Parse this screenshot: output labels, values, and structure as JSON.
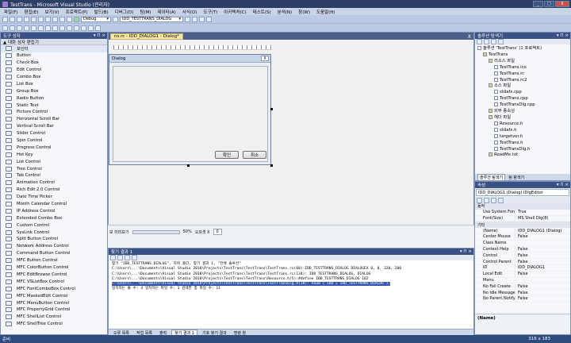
{
  "window": {
    "title": "TestTrans - Microsoft Visual Studio (관리자)",
    "min": "_",
    "max": "□",
    "close": "X"
  },
  "menu": [
    "파일(F)",
    "편집(E)",
    "보기(V)",
    "프로젝트(P)",
    "빌드(B)",
    "디버그(D)",
    "팀(M)",
    "데이터(A)",
    "서식(O)",
    "도구(T)",
    "아키텍처(C)",
    "테스트(S)",
    "분석(N)",
    "창(W)",
    "도움말(H)"
  ],
  "toolbar": {
    "config": "Debug",
    "dialog_id": "IDD_TESTTRANS_DIALOG"
  },
  "toolbox": {
    "title": "도구 상자",
    "group": "▲ 대화 상자 편집기",
    "items": [
      {
        "icon": "pointer-icon",
        "label": "포인터"
      },
      {
        "icon": "button-icon",
        "label": "Button"
      },
      {
        "icon": "check-box-icon",
        "label": "Check Box"
      },
      {
        "icon": "edit-control-icon",
        "label": "Edit Control"
      },
      {
        "icon": "combo-box-icon",
        "label": "Combo Box"
      },
      {
        "icon": "list-box-icon",
        "label": "List Box"
      },
      {
        "icon": "group-box-icon",
        "label": "Group Box"
      },
      {
        "icon": "radio-button-icon",
        "label": "Radio Button"
      },
      {
        "icon": "static-text-icon",
        "label": "Static Text"
      },
      {
        "icon": "picture-control-icon",
        "label": "Picture Control"
      },
      {
        "icon": "h-scroll-icon",
        "label": "Horizontal Scroll Bar"
      },
      {
        "icon": "v-scroll-icon",
        "label": "Vertical Scroll Bar"
      },
      {
        "icon": "slider-icon",
        "label": "Slider Control"
      },
      {
        "icon": "spin-icon",
        "label": "Spin Control"
      },
      {
        "icon": "progress-icon",
        "label": "Progress Control"
      },
      {
        "icon": "hot-key-icon",
        "label": "Hot Key"
      },
      {
        "icon": "list-control-icon",
        "label": "List Control"
      },
      {
        "icon": "tree-control-icon",
        "label": "Tree Control"
      },
      {
        "icon": "tab-control-icon",
        "label": "Tab Control"
      },
      {
        "icon": "animation-icon",
        "label": "Animation Control"
      },
      {
        "icon": "rich-edit-icon",
        "label": "Rich Edit 2.0 Control"
      },
      {
        "icon": "date-time-icon",
        "label": "Date Time Picker"
      },
      {
        "icon": "month-calendar-icon",
        "label": "Month Calendar Control"
      },
      {
        "icon": "ip-address-icon",
        "label": "IP Address Control"
      },
      {
        "icon": "ext-combo-icon",
        "label": "Extended Combo Box"
      },
      {
        "icon": "custom-control-icon",
        "label": "Custom Control"
      },
      {
        "icon": "syslink-icon",
        "label": "SysLink Control"
      },
      {
        "icon": "split-button-icon",
        "label": "Split Button Control"
      },
      {
        "icon": "network-address-icon",
        "label": "Network Address Control"
      },
      {
        "icon": "command-button-icon",
        "label": "Command Button Control"
      },
      {
        "icon": "mfc-button-icon",
        "label": "MFC Button Control"
      },
      {
        "icon": "mfc-colorbutton-icon",
        "label": "MFC ColorButton Control"
      },
      {
        "icon": "mfc-editbrowse-icon",
        "label": "MFC EditBrowse Control"
      },
      {
        "icon": "mfc-vslistbox-icon",
        "label": "MFC VSListBox Control"
      },
      {
        "icon": "mfc-fontcombo-icon",
        "label": "MFC FontComboBox Control"
      },
      {
        "icon": "mfc-maskededit-icon",
        "label": "MFC MaskedEdit Control"
      },
      {
        "icon": "mfc-menubutton-icon",
        "label": "MFC MenuButton Control"
      },
      {
        "icon": "mfc-propertygrid-icon",
        "label": "MFC PropertyGrid Control"
      },
      {
        "icon": "mfc-shelllist-icon",
        "label": "MFC ShellList Control"
      },
      {
        "icon": "mfc-shelltree-icon",
        "label": "MFC ShellTree Control"
      }
    ]
  },
  "doc": {
    "tab": "ns.rc - IDD_DIALOG1 - Dialog*",
    "dialog_title": "Dialog",
    "ok": "확인",
    "cancel": "취소",
    "close": "X"
  },
  "sizer": {
    "label": "보 미리보기",
    "percent": "50%",
    "scale_label": "오프셋 X",
    "value": "0"
  },
  "output": {
    "lines": [
      "찾기 \"IDD_TESTTRANS_DIALOG\", 하위 폴더, 찾기 결과 1, \"전체 솔루션\"",
      "C:\\Users\\...\\Documents\\Visual Studio 2010\\Projects\\TestTrans\\TestTrans\\TestTrans.rc(68):IDD_TESTTRANS_DIALOG DIALOGEX  0, 0, 320, 200",
      "C:\\Users\\...\\Documents\\Visual Studio 2010\\Projects\\TestTrans\\TestTrans\\TestTrans.rc(134):   IDD_TESTTRANS_DIALOG, DIALOG",
      "C:\\Users\\...\\Documents\\Visual Studio 2010\\Projects\\TestTrans\\TestTrans\\Resource.h(5):#define IDD_TESTTRANS_DIALOG              102",
      "C:\\Users\\...\\Documents\\Visual Studio 2010\\Projects\\TestTrans\\TestTrans\\TestTransDlg.h(18):   enum { IDD = IDD_TESTTRANS_DIALOG };",
      "일치하는 줄 수: 4    일치하는 파일 수: 3    검색한 총 파일 수: 11"
    ],
    "highlight_index": 4,
    "tabs": [
      "오류 목록",
      "작업 목록",
      "출력",
      "찾기 결과 1",
      "기호 찾기 결과",
      "명령 창"
    ],
    "active_tab": 3
  },
  "solution": {
    "title": "솔루션 탐색기",
    "nodes": [
      {
        "indent": 0,
        "label": "솔루션 'TestTrans' (1 프로젝트)"
      },
      {
        "indent": 1,
        "label": "TestTrans"
      },
      {
        "indent": 2,
        "label": "리소스 파일"
      },
      {
        "indent": 3,
        "label": "TestTrans.ico"
      },
      {
        "indent": 3,
        "label": "TestTrans.rc"
      },
      {
        "indent": 3,
        "label": "TestTrans.rc2"
      },
      {
        "indent": 2,
        "label": "소스 파일"
      },
      {
        "indent": 3,
        "label": "stdafx.cpp"
      },
      {
        "indent": 3,
        "label": "TestTrans.cpp"
      },
      {
        "indent": 3,
        "label": "TestTransDlg.cpp"
      },
      {
        "indent": 2,
        "label": "외부 종속성"
      },
      {
        "indent": 2,
        "label": "헤더 파일"
      },
      {
        "indent": 3,
        "label": "Resource.h"
      },
      {
        "indent": 3,
        "label": "stdafx.h"
      },
      {
        "indent": 3,
        "label": "targetver.h"
      },
      {
        "indent": 3,
        "label": "TestTrans.h"
      },
      {
        "indent": 3,
        "label": "TestTransDlg.h"
      },
      {
        "indent": 2,
        "label": "ReadMe.txt"
      }
    ],
    "tabs": [
      "솔루션 탐색기",
      "팀 탐색기"
    ]
  },
  "properties": {
    "title": "속성",
    "object": "IDD_DIALOG1 (Dialog) IDlgEditor",
    "rows": [
      {
        "cat": true,
        "name": "동작"
      },
      {
        "name": "Use System Font",
        "value": "True"
      },
      {
        "name": "Font(Size)",
        "value": "MS Shell Dlg(8)"
      },
      {
        "cat": true,
        "name": "기타"
      },
      {
        "name": "(Name)",
        "value": "IDD_DIALOG1 (Dialog)"
      },
      {
        "name": "Center Mouse",
        "value": "False"
      },
      {
        "name": "Class Name",
        "value": ""
      },
      {
        "name": "Context Help",
        "value": "False"
      },
      {
        "name": "Control",
        "value": "False"
      },
      {
        "name": "Control Parent",
        "value": "False"
      },
      {
        "name": "ID",
        "value": "IDD_DIALOG1"
      },
      {
        "name": "Local Edit",
        "value": "False"
      },
      {
        "name": "Menu",
        "value": ""
      },
      {
        "name": "No Fail Create",
        "value": "False"
      },
      {
        "name": "No Idle Message",
        "value": "False"
      },
      {
        "name": "No Parent Notify",
        "value": "False"
      }
    ],
    "desc": "(Name)"
  },
  "status": {
    "text": "준비",
    "size": "316 x 183"
  }
}
